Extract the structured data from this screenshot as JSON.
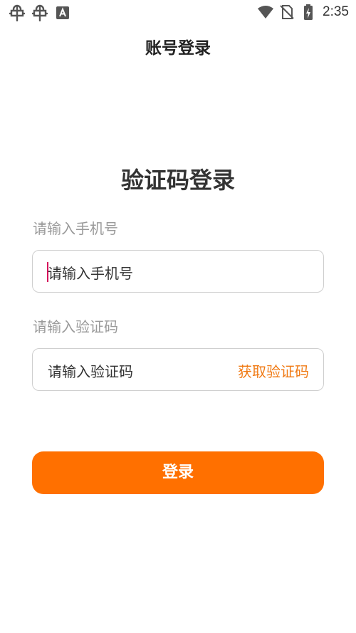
{
  "status_bar": {
    "time": "2:35",
    "left_icons": [
      "bug-icon",
      "bug-icon",
      "font-icon"
    ],
    "right_icons": [
      "wifi-icon",
      "no-sim-icon",
      "battery-charging-icon"
    ]
  },
  "header": {
    "title": "账号登录"
  },
  "form": {
    "heading": "验证码登录",
    "phone": {
      "label": "请输入手机号",
      "placeholder": "请输入手机号"
    },
    "code": {
      "label": "请输入验证码",
      "placeholder": "请输入验证码",
      "get_code_label": "获取验证码"
    },
    "submit_label": "登录"
  },
  "colors": {
    "accent": "#ff7000",
    "link": "#f07a14",
    "caret": "#d6105c",
    "label": "#9a9a9a"
  }
}
